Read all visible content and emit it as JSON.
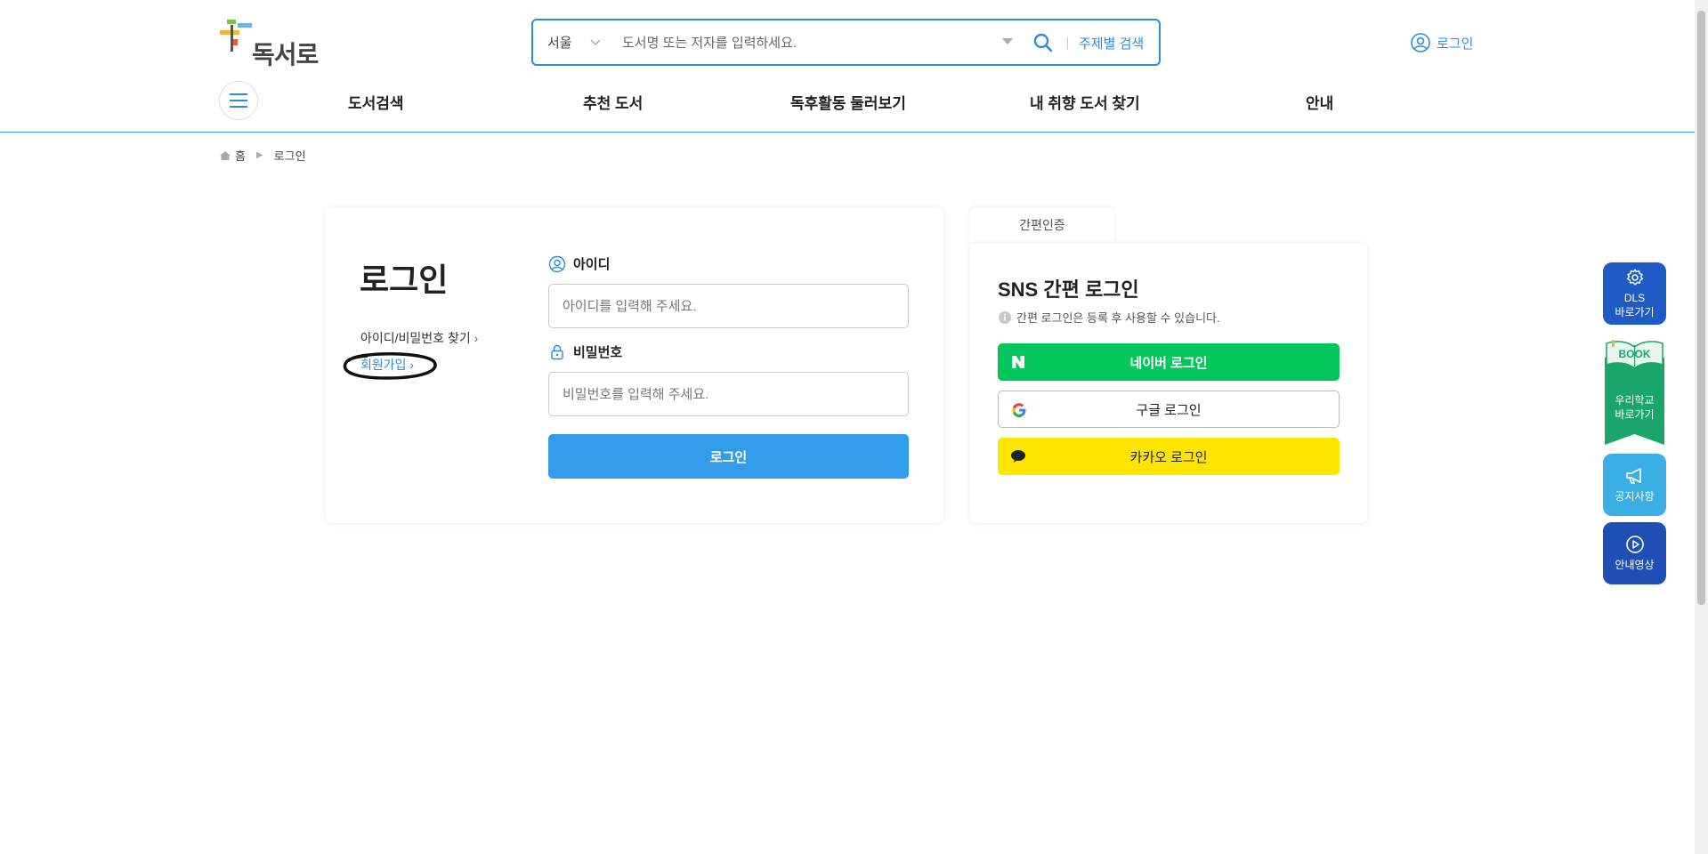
{
  "header": {
    "logo_text": "독서로",
    "search": {
      "region": "서울",
      "placeholder": "도서명 또는 저자를 입력하세요.",
      "topic_search": "주제별 검색"
    },
    "login_link": "로그인",
    "nav": [
      "도서검색",
      "추천 도서",
      "독후활동 둘러보기",
      "내 취향 도서 찾기",
      "안내"
    ]
  },
  "breadcrumb": {
    "home": "홈",
    "current": "로그인"
  },
  "login": {
    "title": "로그인",
    "find_link": "아이디/비밀번호 찾기",
    "join_link": "회원가입",
    "id_label": "아이디",
    "id_placeholder": "아이디를 입력해 주세요.",
    "pw_label": "비밀번호",
    "pw_placeholder": "비밀번호를 입력해 주세요.",
    "submit": "로그인"
  },
  "sns": {
    "tab": "간편인증",
    "title": "SNS 간편 로그인",
    "note": "간편 로그인은 등록 후 사용할 수 있습니다.",
    "naver": "네이버 로그인",
    "google": "구글 로그인",
    "kakao": "카카오 로그인"
  },
  "floating": {
    "dls_line1": "DLS",
    "dls_line2": "바로가기",
    "book_badge": "BOOK",
    "book_line1": "우리학교",
    "book_line2": "바로가기",
    "notice": "공지사항",
    "video": "안내영상"
  },
  "colors": {
    "accent": "#2b8fd6",
    "naver": "#03c75a",
    "kakao": "#fee500",
    "submit": "#339cea"
  }
}
